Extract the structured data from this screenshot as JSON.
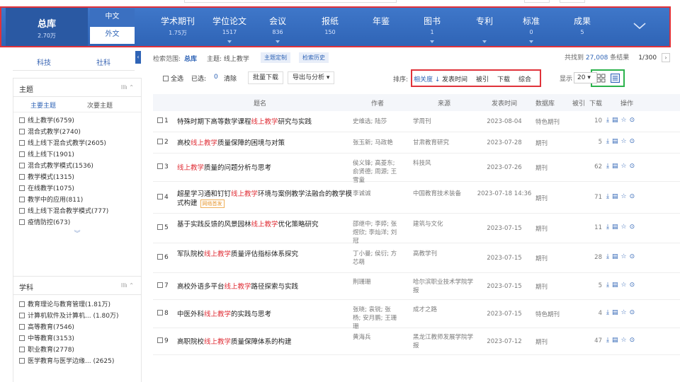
{
  "nav": {
    "total": {
      "label": "总库",
      "count": "2.70万"
    },
    "lang": {
      "zh": "中文",
      "foreign": "外文"
    },
    "items": [
      {
        "label": "学术期刊",
        "count": "1.75万"
      },
      {
        "label": "学位论文",
        "count": "1517"
      },
      {
        "label": "会议",
        "count": "836"
      },
      {
        "label": "报纸",
        "count": "150"
      },
      {
        "label": "年鉴",
        "count": ""
      },
      {
        "label": "图书",
        "count": "1"
      },
      {
        "label": "专利",
        "count": ""
      },
      {
        "label": "标准",
        "count": "0"
      },
      {
        "label": "成果",
        "count": "5"
      }
    ]
  },
  "sidebar": {
    "tabs": [
      "科技",
      "社科"
    ],
    "topic": {
      "title": "主题",
      "subtabs": [
        "主要主题",
        "次要主题"
      ],
      "items": [
        "线上教学(6759)",
        "混合式教学(2740)",
        "线上线下混合式教学(2605)",
        "线上线下(1901)",
        "混合式教学模式(1536)",
        "教学模式(1315)",
        "在线教学(1075)",
        "教学中的应用(811)",
        "线上线下混合教学模式(777)",
        "疫情防控(673)"
      ]
    },
    "subject": {
      "title": "学科",
      "items": [
        "教育理论与教育管理(1.81万)",
        "计算机软件及计算机... (1.80万)",
        "高等教育(7546)",
        "中等教育(3153)",
        "职业教育(2778)",
        "医学教育与医学边缘... (2625)"
      ]
    }
  },
  "search": {
    "scope_label": "检索范围:",
    "scope_value": "总库",
    "topic_label": "主题: 线上教学",
    "btn_custom": "主题定制",
    "btn_history": "检索历史",
    "result_pre": "共找到",
    "result_count": "27,008",
    "result_post": "条结果",
    "page": "1/300"
  },
  "toolbar": {
    "select_all": "全选",
    "selected": "已选:",
    "selected_count": "0",
    "clear": "清除",
    "batch_download": "批量下载",
    "export": "导出与分析 ▾",
    "sort_label": "排序:",
    "sort_options": [
      "相关度 ↓",
      "发表时间",
      "被引",
      "下载",
      "综合"
    ],
    "display_label": "显示",
    "page_size": "20 ▾"
  },
  "table": {
    "headers": [
      "题名",
      "作者",
      "来源",
      "发表时间",
      "数据库",
      "被引",
      "下载",
      "操作"
    ],
    "rows": [
      {
        "no": "1",
        "pre": "特殊时期下高等数学课程",
        "hl": "线上教学",
        "post": "研究与实践",
        "author": "史维选; 陆莎",
        "source": "学周刊",
        "date": "2023-08-04",
        "db": "特色期刊",
        "dl": "10"
      },
      {
        "no": "2",
        "pre": "高校",
        "hl": "线上教学",
        "post": "质量保障的困境与对策",
        "author": "张玉新; 马政艳",
        "source": "甘肃教育研究",
        "date": "2023-07-28",
        "db": "期刊",
        "dl": "5"
      },
      {
        "no": "3",
        "pre": "",
        "hl": "线上教学",
        "post": "质量的问题分析与思考",
        "author": "侯义锋; 高菱东; 俞贤德; 周源; 王雪童",
        "source": "科技风",
        "date": "2023-07-26",
        "db": "期刊",
        "dl": "62"
      },
      {
        "no": "4",
        "pre": "超星学习通和钉钉",
        "hl": "线上教学",
        "post": "环境与案例教学法融合的教学模式构建",
        "tag": "网络首发",
        "author": "李诚诚",
        "source": "中国教育技术装备",
        "date": "2023-07-18 14:36",
        "db": "期刊",
        "dl": "71"
      },
      {
        "no": "5",
        "pre": "基于实践反馈的风景园林",
        "hl": "线上教学",
        "post": "优化策略研究",
        "author": "邵继中; 李婷; 张煜欣; 李灿洋; 刘冠",
        "source": "建筑与文化",
        "date": "2023-07-15",
        "db": "期刊",
        "dl": "11"
      },
      {
        "no": "6",
        "pre": "军队院校",
        "hl": "线上教学",
        "post": "质量评估指标体系探究",
        "author": "丁小曼; 侯衍; 方芯萌",
        "source": "高教学刊",
        "date": "2023-07-15",
        "db": "期刊",
        "dl": "28"
      },
      {
        "no": "7",
        "pre": "高校外语多平台",
        "hl": "线上教学",
        "post": "路径探索与实践",
        "author": "荆珊珊",
        "source": "哈尔滨职业技术学院学报",
        "date": "2023-07-15",
        "db": "期刊",
        "dl": "5"
      },
      {
        "no": "8",
        "pre": "中医外科",
        "hl": "线上教学",
        "post": "的实践与思考",
        "author": "张晓; 袁锐; 张杨; 安月鹏; 王珊珊",
        "source": "成才之路",
        "date": "2023-07-15",
        "db": "特色期刊",
        "dl": "4"
      },
      {
        "no": "9",
        "pre": "高职院校",
        "hl": "线上教学",
        "post": "质量保障体系的构建",
        "author": "黄海兵",
        "source": "黑龙江教师发展学院学报",
        "date": "2023-07-12",
        "db": "期刊",
        "dl": "47"
      }
    ]
  },
  "colors": {
    "accent": "#2f64b6",
    "highlight": "#e0323a",
    "red_box": "#e0323a",
    "green_box": "#2bb24c"
  }
}
